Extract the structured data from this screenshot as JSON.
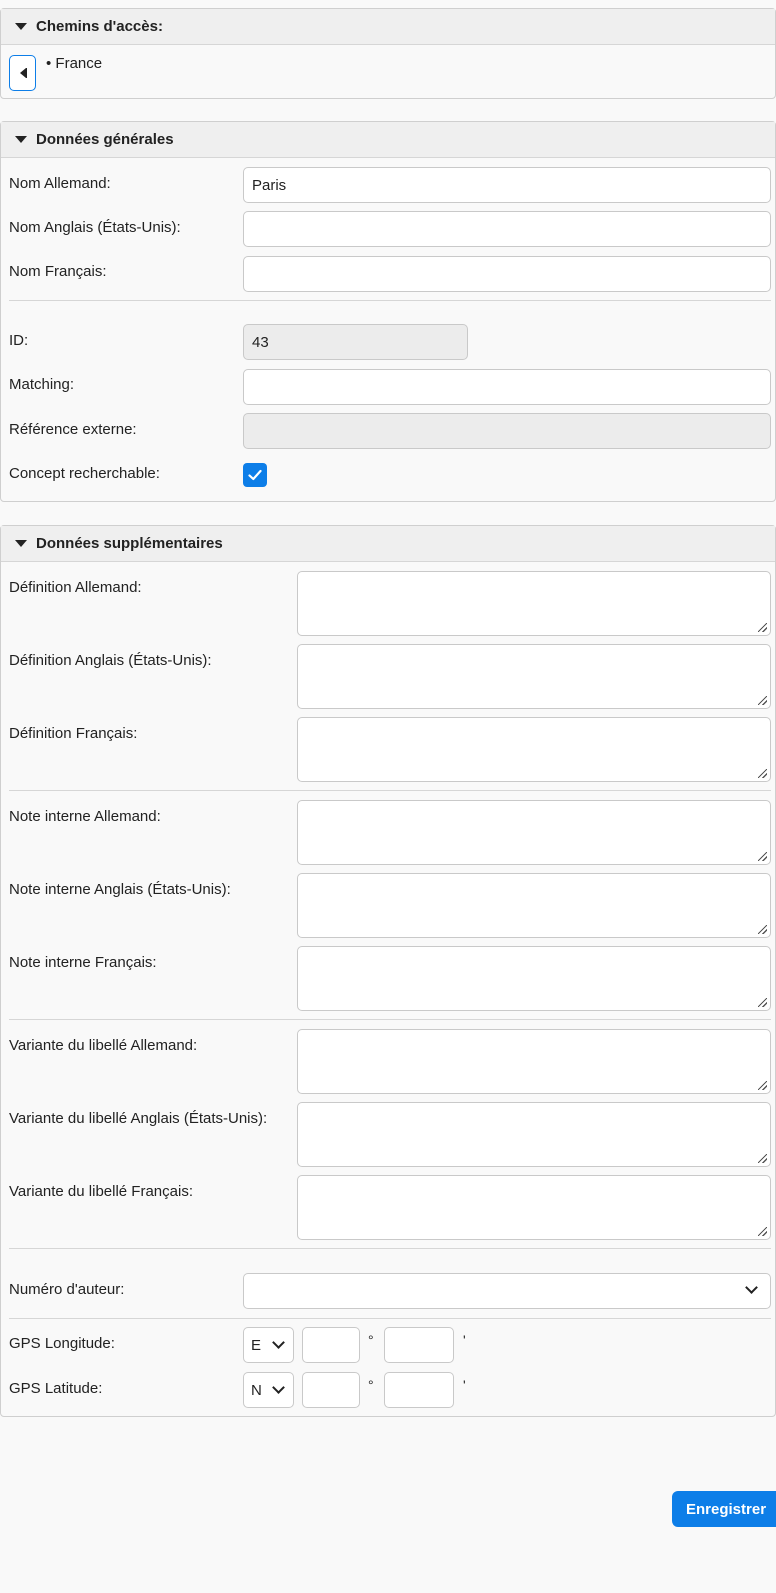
{
  "paths": {
    "title": "Chemins d'accès:",
    "items": [
      "France"
    ]
  },
  "general": {
    "title": "Données générales",
    "name_de_label": "Nom Allemand:",
    "name_de_value": "Paris",
    "name_en_label": "Nom Anglais (États-Unis):",
    "name_en_value": "",
    "name_fr_label": "Nom Français:",
    "name_fr_value": "",
    "id_label": "ID:",
    "id_value": "43",
    "matching_label": "Matching:",
    "matching_value": "",
    "external_ref_label": "Référence externe:",
    "external_ref_value": "",
    "searchable_label": "Concept recherchable:",
    "searchable_checked": true
  },
  "extra": {
    "title": "Données supplémentaires",
    "def_de_label": "Définition Allemand:",
    "def_en_label": "Définition Anglais (États-Unis):",
    "def_fr_label": "Définition Français:",
    "note_de_label": "Note interne Allemand:",
    "note_en_label": "Note interne Anglais (États-Unis):",
    "note_fr_label": "Note interne Français:",
    "variant_de_label": "Variante du libellé Allemand:",
    "variant_en_label": "Variante du libellé Anglais (États-Unis):",
    "variant_fr_label": "Variante du libellé Français:",
    "author_label": "Numéro d'auteur:",
    "author_value": "",
    "gps_lon_label": "GPS Longitude:",
    "gps_lon_dir": "E",
    "gps_lat_label": "GPS Latitude:",
    "gps_lat_dir": "N",
    "degree_symbol": "°",
    "minute_symbol": "'"
  },
  "actions": {
    "save_label": "Enregistrer"
  },
  "colors": {
    "accent": "#0d7ee8"
  }
}
